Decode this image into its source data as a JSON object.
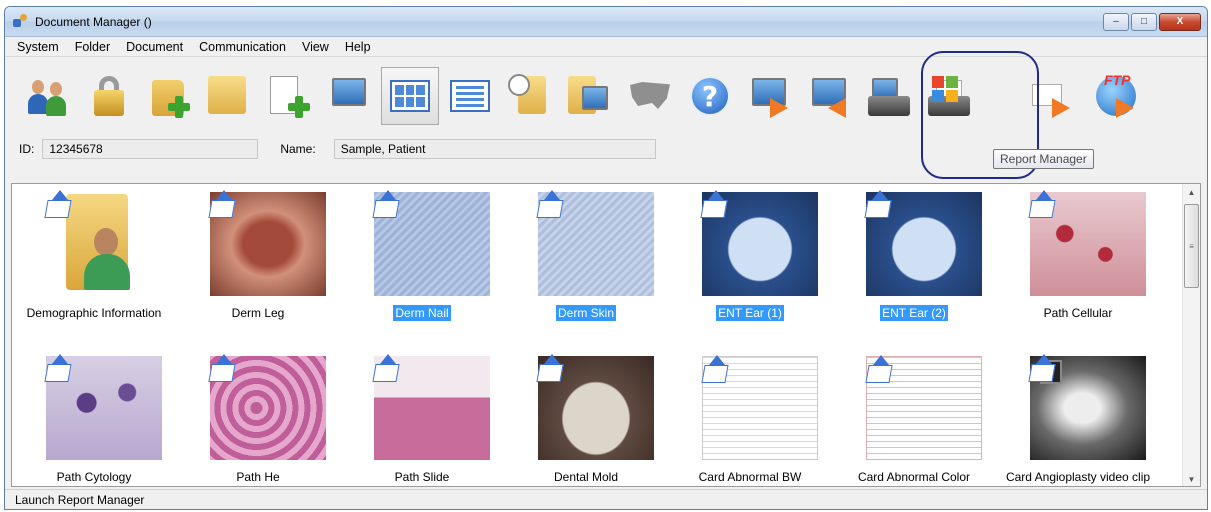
{
  "window": {
    "title": "Document Manager ()",
    "controls": {
      "minimize": "–",
      "maximize": "□",
      "close": "X"
    }
  },
  "menu": [
    "System",
    "Folder",
    "Document",
    "Communication",
    "View",
    "Help"
  ],
  "toolbar": {
    "items": [
      "users-icon",
      "lock-icon",
      "new-folder-icon",
      "open-folder-icon",
      "new-document-icon",
      "import-image-icon",
      "thumbnail-view-icon",
      "list-view-icon",
      "history-icon",
      "folder-images-icon",
      "map-icon",
      "help-icon",
      "export-icon",
      "import-icon",
      "print-icon",
      "report-manager-icon",
      "email-icon",
      "ftp-icon"
    ],
    "ftp_text": "FTP",
    "help_glyph": "?",
    "tooltip": "Report Manager",
    "highlight_color": "#1f2a8a"
  },
  "patient": {
    "id_label": "ID:",
    "id_value": "12345678",
    "name_label": "Name:",
    "name_value": "Sample, Patient"
  },
  "thumbnails": [
    {
      "label": "Demographic Information",
      "selected": false,
      "kind": "person-folder"
    },
    {
      "label": "Derm Leg",
      "selected": false,
      "kind": "leg"
    },
    {
      "label": "Derm Nail",
      "selected": true,
      "kind": "nail"
    },
    {
      "label": "Derm Skin",
      "selected": true,
      "kind": "skin"
    },
    {
      "label": "ENT Ear (1)",
      "selected": true,
      "kind": "ear"
    },
    {
      "label": "ENT Ear (2)",
      "selected": true,
      "kind": "ear"
    },
    {
      "label": "Path Cellular",
      "selected": false,
      "kind": "cell"
    },
    {
      "label": "Path Cytology",
      "selected": false,
      "kind": "cyto"
    },
    {
      "label": "Path He",
      "selected": false,
      "kind": "he"
    },
    {
      "label": "Path Slide",
      "selected": false,
      "kind": "slide"
    },
    {
      "label": "Dental Mold",
      "selected": false,
      "kind": "dental"
    },
    {
      "label": "Card Abnormal BW",
      "selected": false,
      "kind": "ecg"
    },
    {
      "label": "Card Abnormal Color",
      "selected": false,
      "kind": "ecgc"
    },
    {
      "label": "Card Angioplasty video clip",
      "selected": false,
      "kind": "angio"
    }
  ],
  "status": {
    "text": "Launch Report Manager"
  },
  "colors": {
    "selection": "#3399ff",
    "title_gradient_top": "#dbe8f6"
  }
}
